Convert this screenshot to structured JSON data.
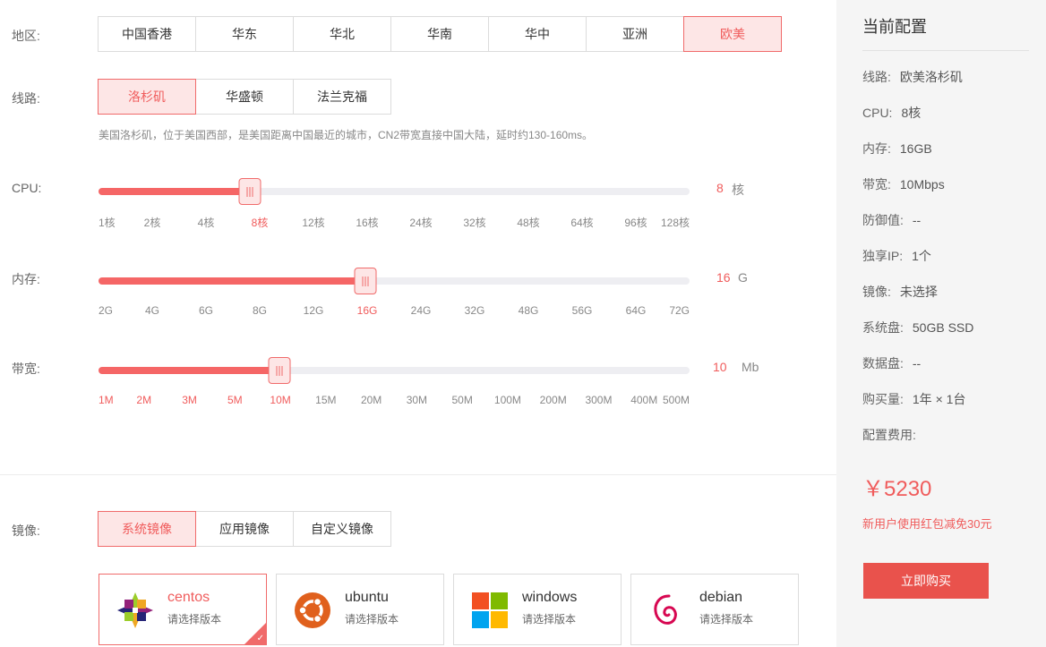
{
  "region": {
    "label": "地区:",
    "options": [
      "中国香港",
      "华东",
      "华北",
      "华南",
      "华中",
      "亚洲",
      "欧美"
    ],
    "selected": "欧美"
  },
  "line": {
    "label": "线路:",
    "options": [
      "洛杉矶",
      "华盛顿",
      "法兰克福"
    ],
    "selected": "洛杉矶",
    "hint": "美国洛杉矶，位于美国西部，是美国距离中国最近的城市，CN2带宽直接中国大陆，延时约130-160ms。"
  },
  "cpu": {
    "label": "CPU:",
    "ticks": [
      "1核",
      "2核",
      "4核",
      "8核",
      "12核",
      "16核",
      "24核",
      "32核",
      "48核",
      "64核",
      "96核",
      "128核"
    ],
    "selected_index": 3,
    "value": "8",
    "unit": "核"
  },
  "memory": {
    "label": "内存:",
    "ticks": [
      "2G",
      "4G",
      "6G",
      "8G",
      "12G",
      "16G",
      "24G",
      "32G",
      "48G",
      "56G",
      "64G",
      "72G"
    ],
    "selected_index": 5,
    "value": "16",
    "unit": "G"
  },
  "bandwidth": {
    "label": "带宽:",
    "ticks": [
      "1M",
      "2M",
      "3M",
      "5M",
      "10M",
      "15M",
      "20M",
      "30M",
      "50M",
      "100M",
      "200M",
      "300M",
      "400M",
      "500M"
    ],
    "selected_index": 4,
    "value": "10",
    "unit": "Mb"
  },
  "image": {
    "label": "镜像:",
    "tabs": [
      "系统镜像",
      "应用镜像",
      "自定义镜像"
    ],
    "selected_tab": "系统镜像",
    "os": [
      {
        "name": "centos",
        "sub": "请选择版本",
        "icon": "centos-icon",
        "active": true
      },
      {
        "name": "ubuntu",
        "sub": "请选择版本",
        "icon": "ubuntu-icon",
        "active": false
      },
      {
        "name": "windows",
        "sub": "请选择版本",
        "icon": "windows-icon",
        "active": false
      },
      {
        "name": "debian",
        "sub": "请选择版本",
        "icon": "debian-icon",
        "active": false
      }
    ],
    "check_mark": "✓"
  },
  "summary": {
    "title": "当前配置",
    "items": [
      {
        "k": "线路:",
        "v": "欧美洛杉矶"
      },
      {
        "k": "CPU:",
        "v": "8核"
      },
      {
        "k": "内存:",
        "v": "16GB"
      },
      {
        "k": "带宽:",
        "v": "10Mbps"
      },
      {
        "k": "防御值:",
        "v": "--"
      },
      {
        "k": "独享IP:",
        "v": "1个"
      },
      {
        "k": "镜像:",
        "v": "未选择"
      },
      {
        "k": "系统盘:",
        "v": "50GB SSD"
      },
      {
        "k": "数据盘:",
        "v": "--"
      },
      {
        "k": "购买量:",
        "v": "1年 × 1台"
      },
      {
        "k": "配置费用:",
        "v": ""
      }
    ],
    "price": "￥5230",
    "promo": "新用户使用红包减免30元",
    "buy_label": "立即购买"
  },
  "colors": {
    "accent": "#f05c5c",
    "accent_fill": "#f56666",
    "active_bg": "#fde6e6",
    "buy_bg": "#e9524c",
    "aside_bg": "#f5f5f5"
  }
}
